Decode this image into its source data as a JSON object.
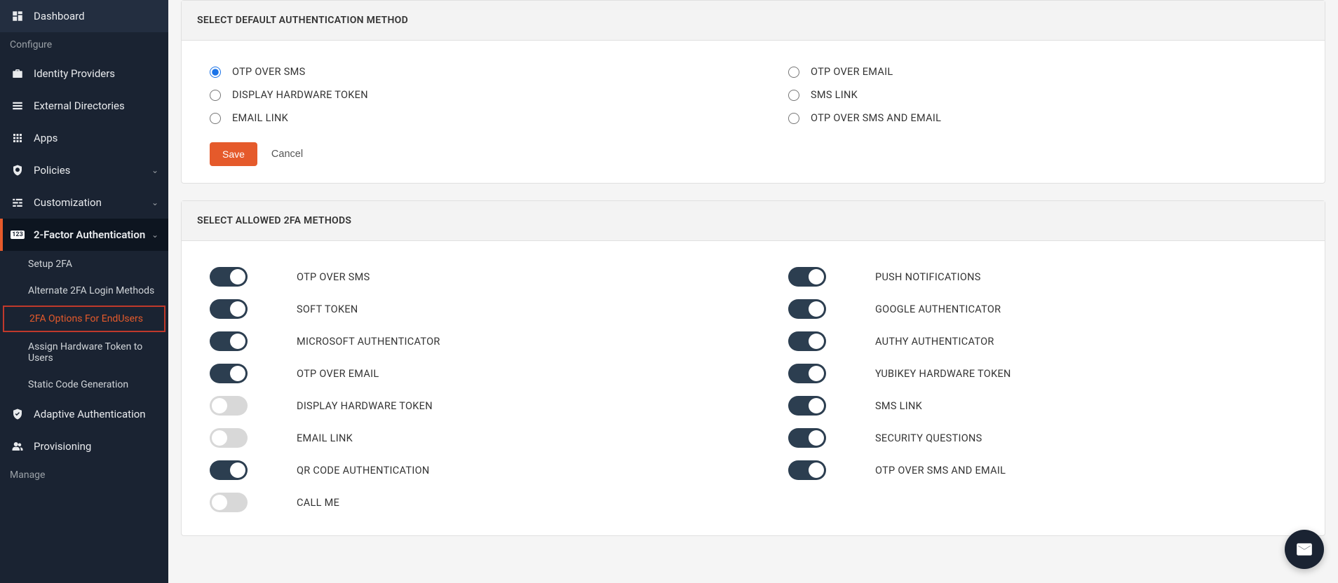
{
  "sidebar": {
    "dashboard": "Dashboard",
    "configure": "Configure",
    "identityProviders": "Identity Providers",
    "externalDirectories": "External Directories",
    "apps": "Apps",
    "policies": "Policies",
    "customization": "Customization",
    "twoFactor": "2-Factor Authentication",
    "sub": {
      "setup2fa": "Setup 2FA",
      "alternate": "Alternate 2FA Login Methods",
      "options": "2FA Options For EndUsers",
      "assignToken": "Assign Hardware Token to Users",
      "staticCode": "Static Code Generation"
    },
    "adaptive": "Adaptive Authentication",
    "provisioning": "Provisioning",
    "manage": "Manage"
  },
  "panel1": {
    "title": "SELECT DEFAULT AUTHENTICATION METHOD",
    "radiosLeft": [
      {
        "label": "OTP OVER SMS",
        "checked": true
      },
      {
        "label": "DISPLAY HARDWARE TOKEN",
        "checked": false
      },
      {
        "label": "EMAIL LINK",
        "checked": false
      }
    ],
    "radiosRight": [
      {
        "label": "OTP OVER EMAIL",
        "checked": false
      },
      {
        "label": "SMS LINK",
        "checked": false
      },
      {
        "label": "OTP OVER SMS AND EMAIL",
        "checked": false
      }
    ],
    "save": "Save",
    "cancel": "Cancel"
  },
  "panel2": {
    "title": "SELECT ALLOWED 2FA METHODS",
    "left": [
      {
        "label": "OTP OVER SMS",
        "on": true
      },
      {
        "label": "SOFT TOKEN",
        "on": true
      },
      {
        "label": "MICROSOFT AUTHENTICATOR",
        "on": true
      },
      {
        "label": "OTP OVER EMAIL",
        "on": true
      },
      {
        "label": "DISPLAY HARDWARE TOKEN",
        "on": false
      },
      {
        "label": "EMAIL LINK",
        "on": false
      },
      {
        "label": "QR CODE AUTHENTICATION",
        "on": true
      },
      {
        "label": "CALL ME",
        "on": false
      }
    ],
    "right": [
      {
        "label": "PUSH NOTIFICATIONS",
        "on": true
      },
      {
        "label": "GOOGLE AUTHENTICATOR",
        "on": true
      },
      {
        "label": "AUTHY AUTHENTICATOR",
        "on": true
      },
      {
        "label": "YUBIKEY HARDWARE TOKEN",
        "on": true
      },
      {
        "label": "SMS LINK",
        "on": true
      },
      {
        "label": "SECURITY QUESTIONS",
        "on": true
      },
      {
        "label": "OTP OVER SMS AND EMAIL",
        "on": true
      }
    ]
  }
}
